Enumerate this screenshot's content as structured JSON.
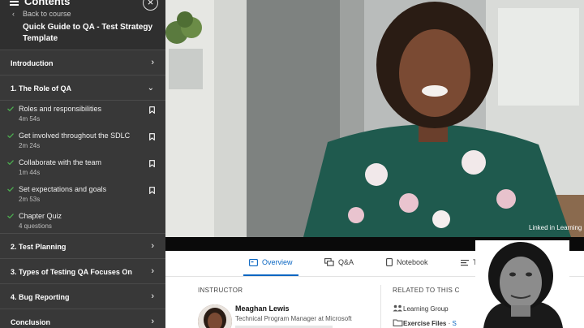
{
  "sidebar": {
    "title": "Contents",
    "back_link": "Back to course",
    "course_title": "Quick Guide to QA - Test Strategy Template",
    "sections": [
      {
        "label": "Introduction"
      },
      {
        "label": "1. The Role of QA"
      },
      {
        "label": "2. Test Planning"
      },
      {
        "label": "3. Types of Testing QA Focuses On"
      },
      {
        "label": "4. Bug Reporting"
      },
      {
        "label": "Conclusion"
      }
    ],
    "lessons": [
      {
        "title": "Roles and responsibilities",
        "duration": "4m 54s"
      },
      {
        "title": "Get involved throughout the SDLC",
        "duration": "2m 24s"
      },
      {
        "title": "Collaborate with the team",
        "duration": "1m 44s"
      },
      {
        "title": "Set expectations and goals",
        "duration": "2m 53s"
      },
      {
        "title": "Chapter Quiz",
        "duration": "4 questions"
      }
    ]
  },
  "video": {
    "watermark": "Linked in Learning"
  },
  "tabs": [
    {
      "label": "Overview",
      "icon": "overview-icon"
    },
    {
      "label": "Q&A",
      "icon": "qa-icon"
    },
    {
      "label": "Notebook",
      "icon": "notebook-icon"
    },
    {
      "label": "T",
      "icon": "transcript-icon"
    }
  ],
  "instructor": {
    "heading": "INSTRUCTOR",
    "name": "Meaghan Lewis",
    "role": "Technical Program Manager at Microsoft"
  },
  "related": {
    "heading": "RELATED TO THIS C",
    "items": [
      {
        "label": "Learning Group",
        "icon": "group-icon"
      },
      {
        "label": "Exercise Files",
        "extra": "S",
        "icon": "folder-icon"
      }
    ]
  },
  "colors": {
    "sidebar_bg": "#383838",
    "accent": "#0a66c2",
    "check": "#4caf50"
  }
}
